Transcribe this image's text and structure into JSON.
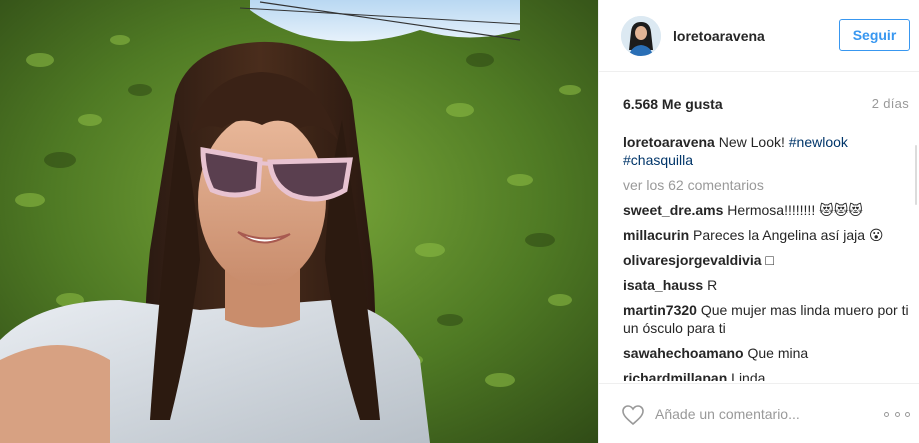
{
  "post": {
    "username": "loretoaravena",
    "follow_label": "Seguir",
    "likes": "6.568 Me gusta",
    "time": "2 días",
    "caption": {
      "user": "loretoaravena",
      "text": "New Look!",
      "tags": [
        "#newlook",
        "#chasquilla"
      ]
    },
    "load_more": "ver los 62 comentarios",
    "comments": [
      {
        "user": "sweet_dre.ams",
        "text": "Hermosa!!!!!!!! 😻😻😻"
      },
      {
        "user": "millacurin",
        "text": "Pareces la Angelina así jaja 😮"
      },
      {
        "user": "olivaresjorgevaldivia",
        "text": "□"
      },
      {
        "user": "isata_hauss",
        "text": "R"
      },
      {
        "user": "martin7320",
        "text": "Que mujer mas linda muero por ti un ósculo para ti"
      },
      {
        "user": "sawahechoamano",
        "text": "Que mina"
      },
      {
        "user": "richardmillapan",
        "text": "Linda"
      }
    ],
    "comment_placeholder": "Añade un comentario...",
    "icons": {
      "like": "heart-icon",
      "options": "more-options-icon"
    },
    "colors": {
      "accent": "#3897f0",
      "hashtag": "#003569",
      "muted": "#999999",
      "text": "#262626"
    }
  }
}
